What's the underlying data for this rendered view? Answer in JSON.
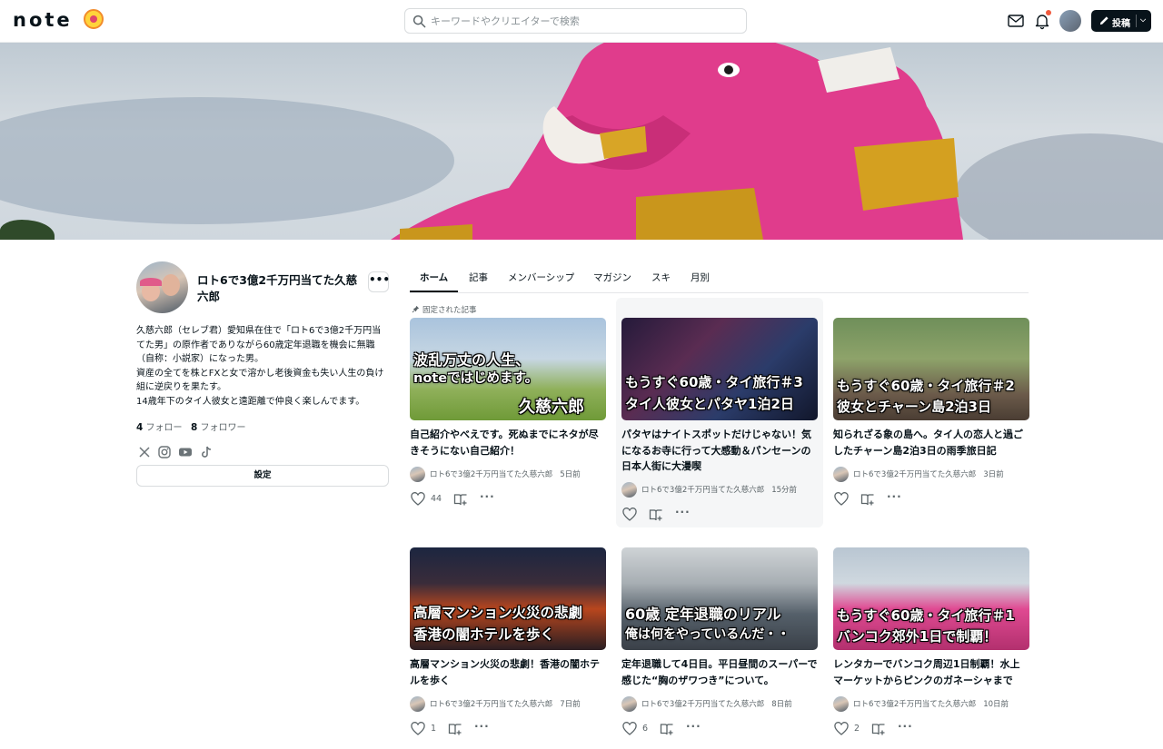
{
  "header": {
    "logo": "note",
    "search_placeholder": "キーワードやクリエイターで検索",
    "post_label": "投稿"
  },
  "profile": {
    "name": "ロト6で3億2千万円当てた久慈六郎",
    "more": "•••",
    "bio": [
      "久慈六郎（セレブ君）愛知県在住で「ロト6で3億2千万円当",
      "てた男」の原作者でありながら60歳定年退職を機会に無職",
      "（自称：小説家）になった男。",
      "資産の全てを株とFXと女で溶かし老後資金も失い人生の負け",
      "組に逆戻りを果たす。",
      "14歳年下のタイ人彼女と遠距離で仲良く楽しんでます。"
    ],
    "follow_count": "4",
    "follow_label": "フォロー",
    "follower_count": "8",
    "follower_label": "フォロワー",
    "settings_label": "設定"
  },
  "tabs": [
    "ホーム",
    "記事",
    "メンバーシップ",
    "マガジン",
    "スキ",
    "月別"
  ],
  "pinned_label": "固定された記事",
  "articles": [
    {
      "thumb_lines": [
        "波乱万丈の人生、",
        "noteではじめます。",
        "久慈六郎"
      ],
      "title": "自己紹介やべえです。死ぬまでにネタが尽きそうにない自己紹介！",
      "author": "ロト6で3億2千万円当てた久慈六郎",
      "time": "5日前",
      "likes": "44"
    },
    {
      "thumb_lines": [
        "もうすぐ60歳・タイ旅行＃3",
        "タイ人彼女とパタヤ1泊2日"
      ],
      "title": "パタヤはナイトスポットだけじゃない！気になるお寺に行って大感動＆パンセーンの日本人街に大漫喫",
      "author": "ロト6で3億2千万円当てた久慈六郎",
      "time": "15分前",
      "likes": ""
    },
    {
      "thumb_lines": [
        "もうすぐ60歳・タイ旅行＃2",
        "彼女とチャーン島2泊3日"
      ],
      "title": "知られざる象の島へ。タイ人の恋人と過ごしたチャーン島2泊3日の雨季旅日記",
      "author": "ロト6で3億2千万円当てた久慈六郎",
      "time": "3日前",
      "likes": ""
    },
    {
      "thumb_lines": [
        "高層マンション火災の悲劇",
        "香港の闇ホテルを歩く"
      ],
      "title": "高層マンション火災の悲劇！香港の闇ホテルを歩く",
      "author": "ロト6で3億2千万円当てた久慈六郎",
      "time": "7日前",
      "likes": "1"
    },
    {
      "thumb_lines": [
        "60歳 定年退職のリアル",
        "俺は何をやっているんだ・・"
      ],
      "title": "定年退職して4日目。平日昼間のスーパーで感じた“胸のザワつき”について。",
      "author": "ロト6で3億2千万円当てた久慈六郎",
      "time": "8日前",
      "likes": "6"
    },
    {
      "thumb_lines": [
        "もうすぐ60歳・タイ旅行＃1",
        "バンコク郊外1日で制覇！"
      ],
      "title": "レンタカーでバンコク周辺1日制覇！水上マーケットからピンクのガネーシャまで",
      "author": "ロト6で3億2千万円当てた久慈六郎",
      "time": "10日前",
      "likes": "2"
    }
  ]
}
